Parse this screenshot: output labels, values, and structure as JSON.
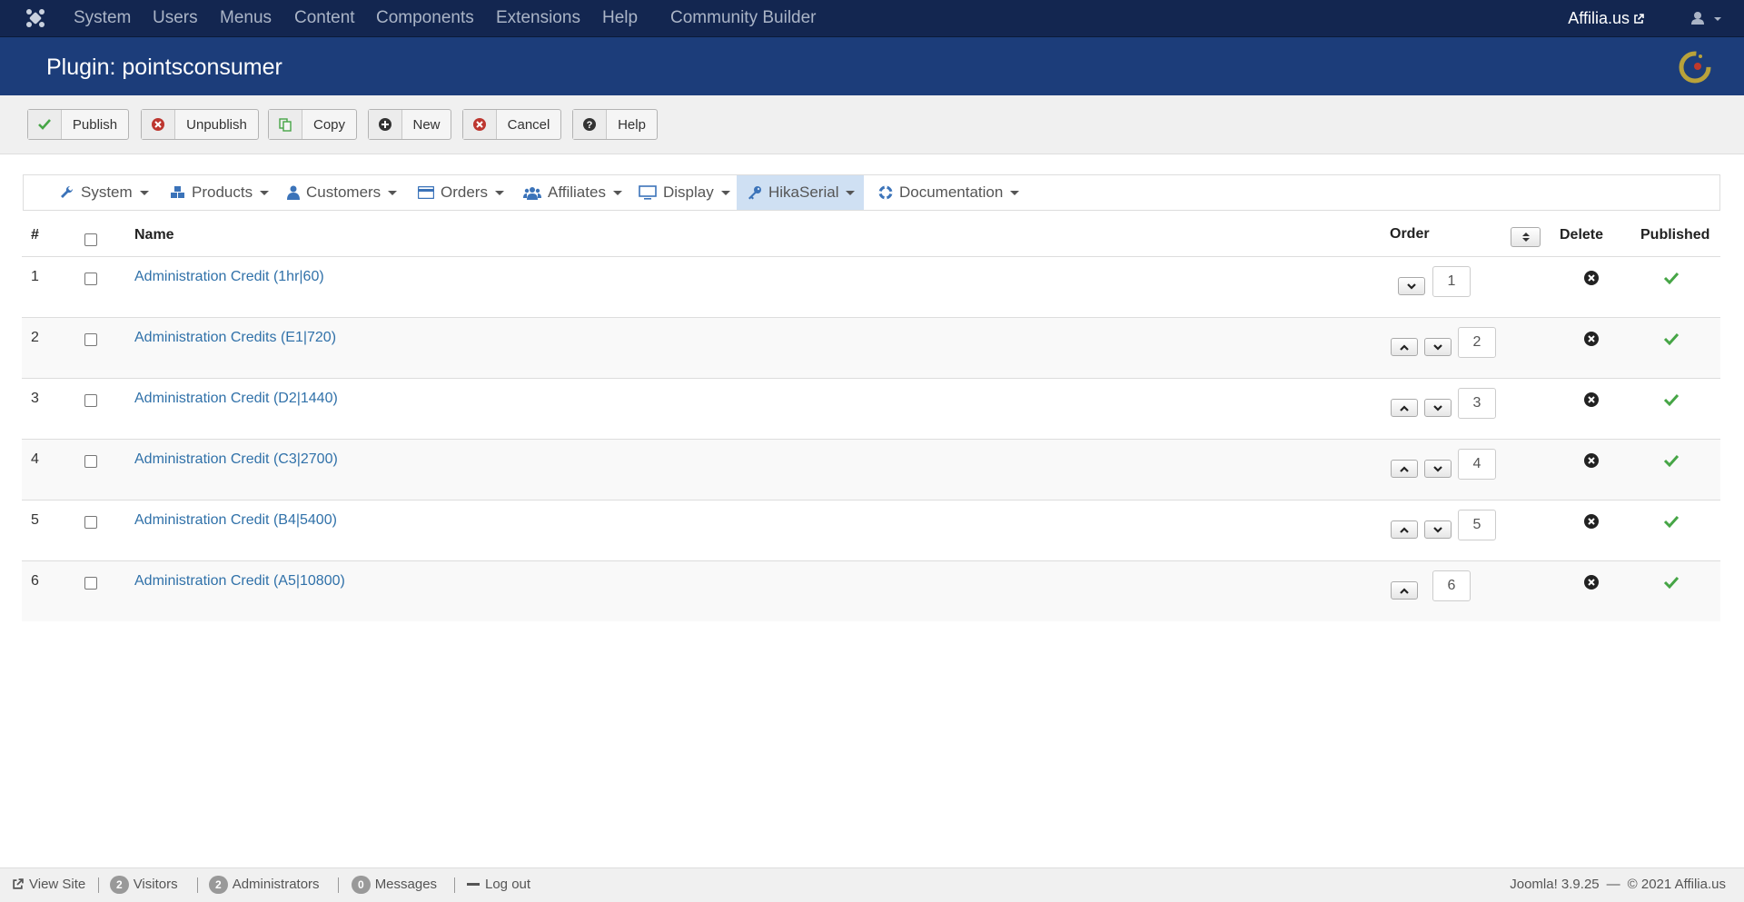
{
  "topnav": {
    "menu": [
      "System",
      "Users",
      "Menus",
      "Content",
      "Components",
      "Extensions",
      "Help",
      "Community Builder"
    ],
    "site_name": "Affilia.us"
  },
  "header": {
    "title": "Plugin: pointsconsumer"
  },
  "toolbar": {
    "publish": "Publish",
    "unpublish": "Unpublish",
    "copy": "Copy",
    "new": "New",
    "cancel": "Cancel",
    "help": "Help"
  },
  "submenu": {
    "items": [
      "System",
      "Products",
      "Customers",
      "Orders",
      "Affiliates",
      "Display",
      "HikaSerial",
      "Documentation"
    ],
    "active": "HikaSerial"
  },
  "table": {
    "headers": {
      "num": "#",
      "name": "Name",
      "order": "Order",
      "delete": "Delete",
      "published": "Published"
    },
    "rows": [
      {
        "num": "1",
        "name": "Administration Credit (1hr|60)",
        "order": "1",
        "published": true
      },
      {
        "num": "2",
        "name": "Administration Credits (E1|720)",
        "order": "2",
        "published": true
      },
      {
        "num": "3",
        "name": "Administration Credit (D2|1440)",
        "order": "3",
        "published": true
      },
      {
        "num": "4",
        "name": "Administration Credit (C3|2700)",
        "order": "4",
        "published": true
      },
      {
        "num": "5",
        "name": "Administration Credit (B4|5400)",
        "order": "5",
        "published": true
      },
      {
        "num": "6",
        "name": "Administration Credit (A5|10800)",
        "order": "6",
        "published": true
      }
    ]
  },
  "statusbar": {
    "view_site": "View Site",
    "visitors_count": "2",
    "visitors_label": "Visitors",
    "admins_count": "2",
    "admins_label": "Administrators",
    "messages_count": "0",
    "messages_label": "Messages",
    "logout": "Log out",
    "version": "Joomla! 3.9.25",
    "copyright": "© 2021 Affilia.us"
  },
  "colors": {
    "topbar": "#132650",
    "titlebar": "#1c3d7a",
    "link": "#3071a9",
    "publish_green": "#46a546",
    "cancel_red": "#bd362f"
  }
}
